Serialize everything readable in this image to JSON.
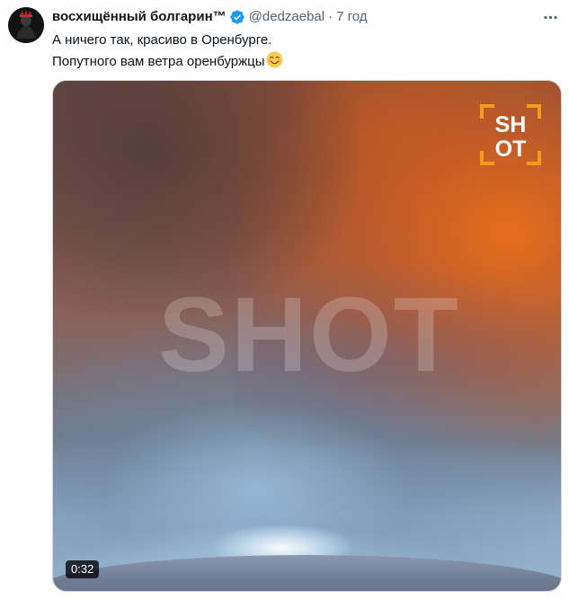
{
  "tweet": {
    "author": {
      "display_name": "восхищённый болгарин™",
      "handle": "@dedzaebal",
      "verified": true,
      "avatar_icon": "avatar-image"
    },
    "separator": "·",
    "timestamp": "7 год",
    "text_line_1": "А ничего так, красиво в Оренбурге.",
    "text_line_2": "Попутного вам ветра оренбуржцы",
    "emoji": "smiling-face-with-smiling-eyes",
    "more_icon": "more-horizontal-icon",
    "media": {
      "type": "video",
      "duration": "0:32",
      "watermark_text": "SHOT",
      "logo_text_top": "SH",
      "logo_text_bottom": "OT"
    }
  },
  "colors": {
    "text_primary": "#0f1419",
    "text_secondary": "#536471",
    "verified_blue": "#1d9bf0",
    "shot_orange": "#f29c1f",
    "media_border": "#cfd9de"
  }
}
